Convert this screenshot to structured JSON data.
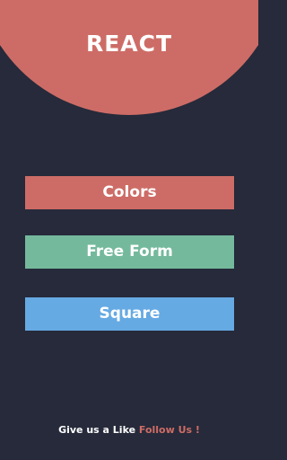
{
  "header": {
    "title": "REACT"
  },
  "menu": {
    "colors_label": "Colors",
    "freeform_label": "Free Form",
    "square_label": "Square"
  },
  "footer": {
    "prompt": "Give us a Like",
    "link_label": "Follow Us !"
  },
  "theme": {
    "background": "#262a3a",
    "accent_red": "#cd6c66",
    "accent_green": "#74b99c",
    "accent_blue": "#66aae3"
  }
}
